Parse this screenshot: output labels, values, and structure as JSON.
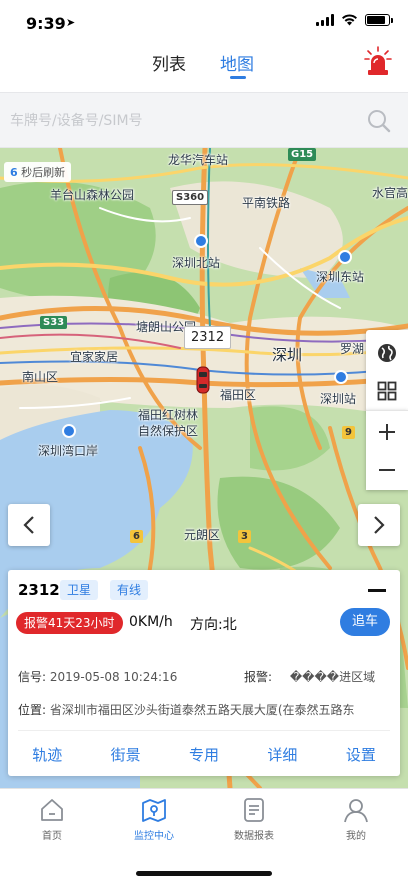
{
  "status_bar": {
    "time": "9:39"
  },
  "nav": {
    "tab_list": "列表",
    "tab_map": "地图"
  },
  "search": {
    "placeholder": "车牌号/设备号/SIM号"
  },
  "map": {
    "refresh_seconds": "6",
    "refresh_text": "秒后刷新",
    "vehicle_label": "2312",
    "labels": {
      "longhua_station": "龙华汽车站",
      "yangtaishan": "羊台山森林公园",
      "s360": "S360",
      "g15": "G15",
      "shenzhen_north": "深圳北站",
      "shenzhen_east": "深圳东站",
      "tanglangshan": "塘朗山公园",
      "s33": "S33",
      "yijiajiaju": "宜家家居",
      "shenzhen": "深圳",
      "nanshan": "南山区",
      "futian": "福田区",
      "luohu": "罗湖",
      "shenzhen_railway": "深圳站",
      "mangrove": "福田红树林",
      "mangrove2": "自然保护区",
      "shenzhen_bay": "深圳湾口岸",
      "yuanlang": "元朗区",
      "shield3": "3",
      "shield9": "9",
      "shield6": "6",
      "shuiguan": "水官高",
      "pingnan": "平南铁路"
    }
  },
  "card": {
    "plate": "2312",
    "tag_satellite": "卫星",
    "tag_wired": "有线",
    "alarm_badge": "报警41天23小时",
    "speed": "0KM/h",
    "heading": "方向:北",
    "chase_button": "追车",
    "signal_label": "信号:",
    "signal_value": "2019-05-08 10:24:16",
    "alarm_label": "报警:",
    "alarm_value": "����进区域",
    "position_label": "位置:",
    "position_value": "省深圳市福田区沙头街道泰然五路天展大厦(在泰然五路东",
    "actions": [
      "轨迹",
      "街景",
      "专用",
      "详细",
      "设置"
    ]
  },
  "tabbar": {
    "items": [
      {
        "label": "首页",
        "icon": "home-icon"
      },
      {
        "label": "监控中心",
        "icon": "monitor-map-icon"
      },
      {
        "label": "数据报表",
        "icon": "report-icon"
      },
      {
        "label": "我的",
        "icon": "user-icon"
      }
    ],
    "active_index": 1
  },
  "colors": {
    "accent": "#2f7de1",
    "alarm_red": "#e0282b"
  }
}
